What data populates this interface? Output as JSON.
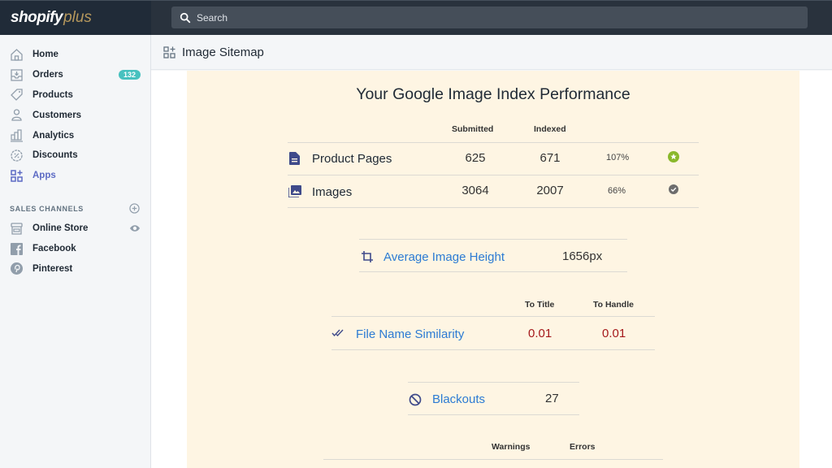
{
  "topbar": {
    "brand_main": "shopify",
    "brand_sub": "plus",
    "search_placeholder": "Search"
  },
  "sidebar": {
    "items": [
      {
        "label": "Home",
        "icon": "home-icon"
      },
      {
        "label": "Orders",
        "icon": "orders-icon",
        "badge": "132"
      },
      {
        "label": "Products",
        "icon": "tag-icon"
      },
      {
        "label": "Customers",
        "icon": "person-icon"
      },
      {
        "label": "Analytics",
        "icon": "bar-chart-icon"
      },
      {
        "label": "Discounts",
        "icon": "discount-icon"
      },
      {
        "label": "Apps",
        "icon": "apps-icon",
        "active": true
      }
    ],
    "section_label": "SALES CHANNELS",
    "channels": [
      {
        "label": "Online Store",
        "icon": "store-icon"
      },
      {
        "label": "Facebook",
        "icon": "facebook-icon"
      },
      {
        "label": "Pinterest",
        "icon": "pinterest-icon"
      }
    ]
  },
  "page": {
    "title": "Image Sitemap"
  },
  "card": {
    "title": "Your Google Image Index Performance",
    "index_table": {
      "headers": [
        "Submitted",
        "Indexed"
      ],
      "rows": [
        {
          "label": "Product Pages",
          "submitted": "625",
          "indexed": "671",
          "percent": "107%",
          "status": "star-badge-icon"
        },
        {
          "label": "Images",
          "submitted": "3064",
          "indexed": "2007",
          "percent": "66%",
          "status": "check-badge-icon"
        }
      ]
    },
    "avg_height": {
      "label": "Average Image Height",
      "value": "1656px"
    },
    "similarity": {
      "headers": [
        "To Title",
        "To Handle"
      ],
      "label": "File Name Similarity",
      "to_title": "0.01",
      "to_handle": "0.01"
    },
    "blackouts": {
      "label": "Blackouts",
      "value": "27"
    },
    "issues": {
      "headers": [
        "Warnings",
        "Errors"
      ]
    }
  },
  "colors": {
    "accent": "#5c6ac4",
    "link": "#2c7bd3",
    "badge": "#47c1bf",
    "error_value": "#a5181b",
    "card_bg": "#fef5e3",
    "success": "#8ab82b"
  }
}
